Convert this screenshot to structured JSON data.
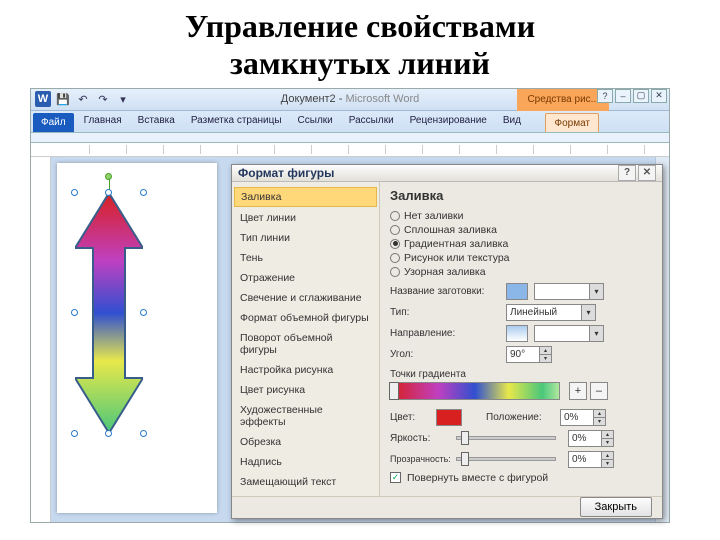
{
  "slide": {
    "title_l1": "Управление свойствами",
    "title_l2": "замкнутых линий"
  },
  "app": {
    "doc_title": "Документ2",
    "ms": "Microsoft Word",
    "contextual": "Средства рис...",
    "tabs": {
      "file": "Файл",
      "home": "Главная",
      "insert": "Вставка",
      "layout": "Разметка страницы",
      "refs": "Ссылки",
      "mail": "Рассылки",
      "review": "Рецензирование",
      "view": "Вид",
      "format": "Формат"
    },
    "qat": {
      "save": "💾",
      "undo": "↶",
      "redo": "↷",
      "more": "▾"
    },
    "win": {
      "min": "–",
      "max": "▢",
      "close": "✕",
      "help": "?"
    }
  },
  "dialog": {
    "title": "Формат фигуры",
    "help": "?",
    "close": "✕",
    "sidebar": [
      "Заливка",
      "Цвет линии",
      "Тип линии",
      "Тень",
      "Отражение",
      "Свечение и сглаживание",
      "Формат объемной фигуры",
      "Поворот объемной фигуры",
      "Настройка рисунка",
      "Цвет рисунка",
      "Художественные эффекты",
      "Обрезка",
      "Надпись",
      "Замещающий текст"
    ],
    "main": {
      "heading": "Заливка",
      "radios": {
        "none": "Нет заливки",
        "solid": "Сплошная заливка",
        "gradient": "Градиентная заливка",
        "picture": "Рисунок или текстура",
        "pattern": "Узорная заливка"
      },
      "preset_lbl": "Название заготовки:",
      "type_lbl": "Тип:",
      "type_val": "Линейный",
      "direction_lbl": "Направление:",
      "angle_lbl": "Угол:",
      "angle_val": "90°",
      "stops_lbl": "Точки градиента",
      "add": "+",
      "remove": "–",
      "color_lbl": "Цвет:",
      "position_lbl": "Положение:",
      "position_val": "0%",
      "brightness_lbl": "Яркость:",
      "brightness_val": "0%",
      "transparency_lbl": "Прозрачность:",
      "transparency_val": "0%",
      "rotate_chk": "Повернуть вместе с фигурой",
      "close_btn": "Закрыть"
    }
  }
}
